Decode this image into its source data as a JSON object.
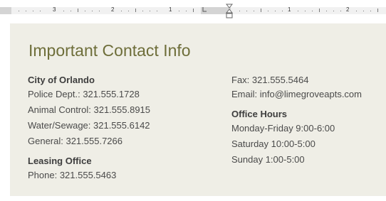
{
  "ruler": {
    "labels": [
      "3",
      "2",
      "1",
      "1",
      "2"
    ]
  },
  "document": {
    "heading": "Important Contact Info",
    "left_column": {
      "city": {
        "title": "City of Orlando",
        "lines": [
          "Police Dept.: 321.555.1728",
          "Animal Control: 321.555.8915",
          "Water/Sewage: 321.555.6142",
          "General: 321.555.7266"
        ]
      },
      "leasing": {
        "title": "Leasing Office",
        "lines": [
          "Phone: 321.555.5463"
        ]
      }
    },
    "right_column": {
      "contact_lines": [
        "Fax: 321.555.5464",
        "Email: info@limegroveapts.com"
      ],
      "hours": {
        "title": "Office Hours",
        "lines": [
          "Monday-Friday 9:00-6:00",
          "Saturday 10:00-5:00",
          "Sunday 1:00-5:00"
        ]
      }
    }
  }
}
